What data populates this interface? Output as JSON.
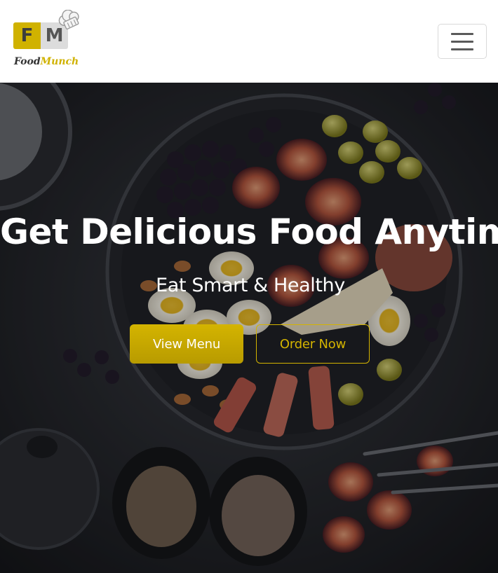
{
  "brand": {
    "badge_left": "F",
    "badge_right": "M",
    "name_part1": "Food",
    "name_part2": "Munch",
    "logo_icon": "chef-hat-icon",
    "accent_color": "#d0b200"
  },
  "nav": {
    "toggler_icon": "hamburger-menu-icon"
  },
  "hero": {
    "title": "Get Delicious Food Anytime",
    "subtitle": "Eat Smart & Healthy",
    "primary_button": "View Menu",
    "secondary_button": "Order Now",
    "background_image": "dark table with plate of figs, eggs, grapes, olives, almonds, prosciutto and cheese"
  }
}
